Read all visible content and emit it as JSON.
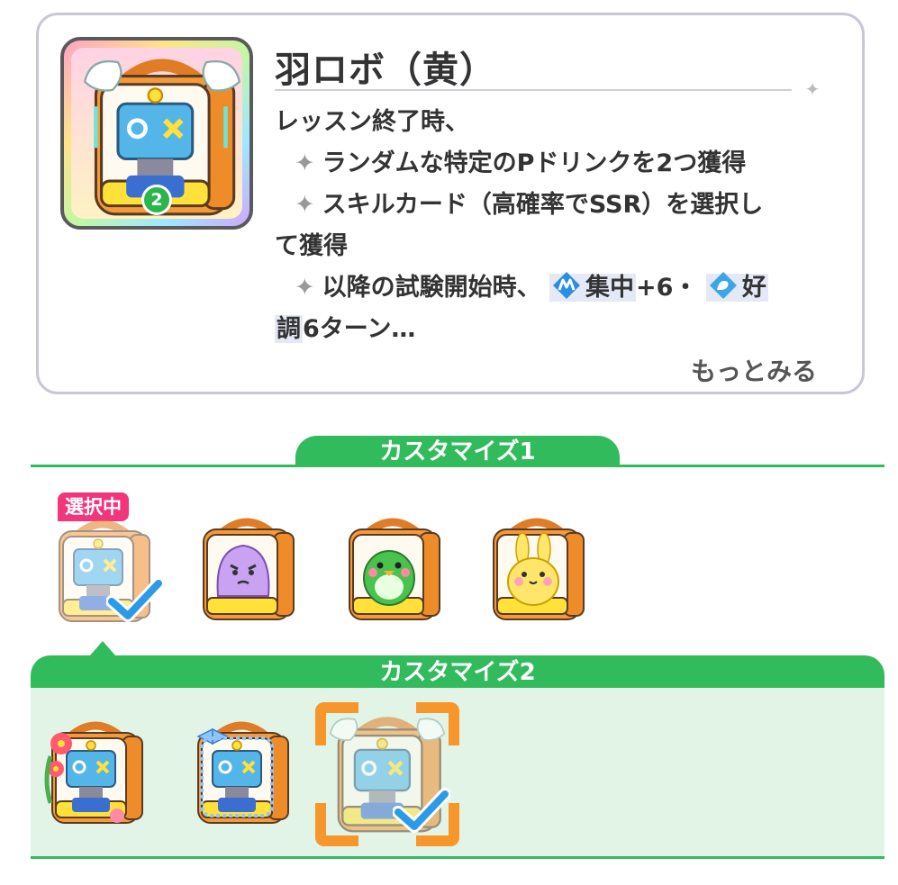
{
  "item": {
    "name": "羽ロボ（黄）",
    "level": "2",
    "description": {
      "line1": "レッスン終了時、",
      "bullet1": "ランダムな特定のPドリンクを2つ獲得",
      "bullet2_a": "スキルカード（高確率でSSR）を選択し",
      "bullet2_b": "て獲得",
      "bullet3_prefix": "以降の試験開始時、",
      "bullet3_buff1": "集中",
      "bullet3_buff1_value": "+6・",
      "bullet3_buff2_a": "好",
      "bullet3_buff2_b": "調",
      "bullet3_tail": "6ターン…"
    },
    "more_label": "もっとみる"
  },
  "customize1": {
    "label": "カスタマイズ1",
    "selected_badge": "選択中",
    "options": [
      {
        "id": "robo-blue",
        "selected": true
      },
      {
        "id": "purple-monster",
        "selected": false
      },
      {
        "id": "green-bird",
        "selected": false
      },
      {
        "id": "yellow-bunny",
        "selected": false
      }
    ]
  },
  "customize2": {
    "label": "カスタマイズ2",
    "options": [
      {
        "id": "flower-deco",
        "selected": false
      },
      {
        "id": "ribbon-deco",
        "selected": false
      },
      {
        "id": "wing-deco",
        "selected": true
      }
    ]
  },
  "colors": {
    "accent_green": "#32bb5c",
    "badge_pink": "#f2367b",
    "focus_orange": "#f7962b",
    "check_blue": "#2b9ae8"
  },
  "icons": [
    "sparkle-icon",
    "concentration-buff-icon",
    "good-condition-buff-icon",
    "checkmark-icon",
    "level-badge-icon"
  ]
}
